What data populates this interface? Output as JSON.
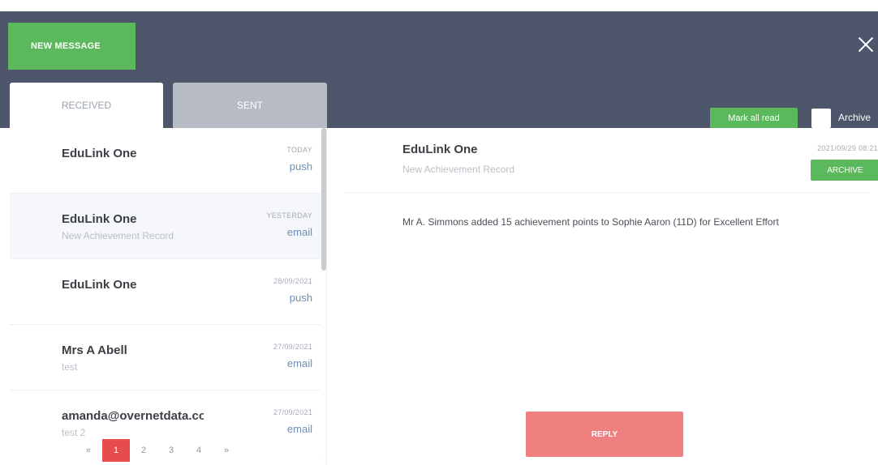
{
  "header": {
    "new_message_label": "NEW MESSAGE",
    "mark_all_read_label": "Mark all read",
    "archive_label": "Archive"
  },
  "tabs": {
    "received": "RECEIVED",
    "sent": "SENT"
  },
  "messages": [
    {
      "sender": "EduLink One",
      "subject": "",
      "date": "TODAY",
      "channel": "push"
    },
    {
      "sender": "EduLink One",
      "subject": "New Achievement Record",
      "date": "YESTERDAY",
      "channel": "email"
    },
    {
      "sender": "EduLink One",
      "subject": "",
      "date": "28/09/2021",
      "channel": "push"
    },
    {
      "sender": "Mrs A Abell",
      "subject": "test",
      "date": "27/09/2021",
      "channel": "email"
    },
    {
      "sender": "amanda@overnetdata.co",
      "subject": "test 2",
      "date": "27/09/2021",
      "channel": "email"
    }
  ],
  "pagination": {
    "prev": "«",
    "pages": [
      "1",
      "2",
      "3",
      "4"
    ],
    "next": "»",
    "current": "1"
  },
  "detail": {
    "sender": "EduLink One",
    "subject": "New Achievement Record",
    "datetime": "2021/09/29 08:21",
    "archive_label": "ARCHIVE",
    "body": "Mr A. Simmons added 15 achievement points to Sophie Aaron (11D) for Excellent Effort",
    "reply_label": "REPLY"
  },
  "colors": {
    "header_bg": "#4e566b",
    "primary_green": "#5cb85c",
    "reply_red": "#f08080",
    "active_page": "#e74c4c"
  }
}
